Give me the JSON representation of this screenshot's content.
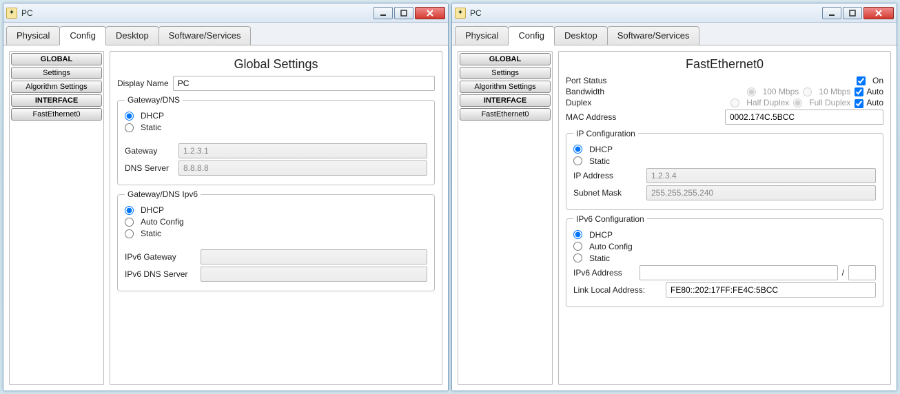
{
  "left": {
    "title": "PC",
    "tabs": [
      "Physical",
      "Config",
      "Desktop",
      "Software/Services"
    ],
    "active_tab": 1,
    "side": {
      "global_header": "GLOBAL",
      "settings": "Settings",
      "algo": "Algorithm Settings",
      "iface_header": "INTERFACE",
      "fe0": "FastEthernet0"
    },
    "panel_title": "Global Settings",
    "display_name_label": "Display Name",
    "display_name_value": "PC",
    "grp1": {
      "legend": "Gateway/DNS",
      "dhcp": "DHCP",
      "static": "Static",
      "gateway_label": "Gateway",
      "gateway_value": "1.2.3.1",
      "dns_label": "DNS Server",
      "dns_value": "8.8.8.8"
    },
    "grp2": {
      "legend": "Gateway/DNS Ipv6",
      "dhcp": "DHCP",
      "auto": "Auto Config",
      "static": "Static",
      "gw6_label": "IPv6 Gateway",
      "gw6_value": "",
      "dns6_label": "IPv6 DNS Server",
      "dns6_value": ""
    }
  },
  "right": {
    "title": "PC",
    "tabs": [
      "Physical",
      "Config",
      "Desktop",
      "Software/Services"
    ],
    "active_tab": 1,
    "side": {
      "global_header": "GLOBAL",
      "settings": "Settings",
      "algo": "Algorithm Settings",
      "iface_header": "INTERFACE",
      "fe0": "FastEthernet0"
    },
    "panel_title": "FastEthernet0",
    "port_status_label": "Port Status",
    "port_status_on": "On",
    "bandwidth_label": "Bandwidth",
    "bw_100": "100 Mbps",
    "bw_10": "10 Mbps",
    "bw_auto": "Auto",
    "duplex_label": "Duplex",
    "half": "Half Duplex",
    "full": "Full Duplex",
    "dup_auto": "Auto",
    "mac_label": "MAC Address",
    "mac_value": "0002.174C.5BCC",
    "ipconf": {
      "legend": "IP Configuration",
      "dhcp": "DHCP",
      "static": "Static",
      "ip_label": "IP Address",
      "ip_value": "1.2.3.4",
      "mask_label": "Subnet Mask",
      "mask_value": "255.255.255.240"
    },
    "ip6conf": {
      "legend": "IPv6 Configuration",
      "dhcp": "DHCP",
      "auto": "Auto Config",
      "static": "Static",
      "addr_label": "IPv6 Address",
      "addr_value": "",
      "prefix_sep": "/",
      "ll_label": "Link Local Address:",
      "ll_value": "FE80::202:17FF:FE4C:5BCC"
    }
  }
}
